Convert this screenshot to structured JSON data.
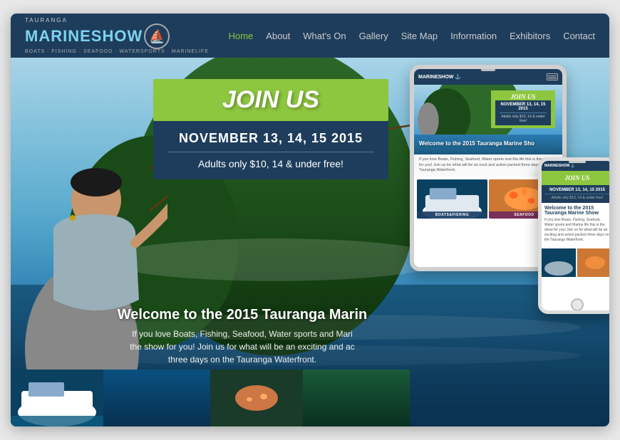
{
  "site": {
    "logo": {
      "top": "TAURANGA",
      "main_marine": "MARINE",
      "main_show": "SHOW",
      "sub": "BOATS · FISHING · SEAFOOD · WATERSPORTS · MARINELIFE"
    },
    "nav": {
      "home": "Home",
      "about": "About",
      "whats_on": "What's On",
      "gallery": "Gallery",
      "site_map": "Site Map",
      "information": "Information",
      "exhibitors": "Exhibitors",
      "contact": "Contact"
    },
    "hero": {
      "join_us": "JOIN US",
      "date": "NOVEMBER 13, 14, 15 2015",
      "price": "Adults only $10, 14 & under free!",
      "welcome_title": "Welcome to the 2015 Tauranga Marin",
      "welcome_desc_line1": "If you love Boats, Fishing, Seafood, Water sports and Mari",
      "welcome_desc_line2": "the show for you! Join us for what will be an exciting and ac",
      "welcome_desc_line3": "three days on the Tauranga Waterfront."
    },
    "ipad": {
      "logo": "MARINESHOW ⚓",
      "join_us": "JOIN US",
      "date": "NOVEMBER 13, 14, 15 2015",
      "price": "Adults only $10, 14 & under free!",
      "welcome_title": "Welcome to the 2015 Tauranga Marine Sho",
      "desc": "If you love Boats, Fishing, Seafood, Water sports and Ma life this is the show for you! Join us for what will be an excit and action packed three days on the Tauranga Waterfront.",
      "gallery_boat": "BOATS&FISHING",
      "gallery_seafood": "SEAFOOD"
    },
    "iphone": {
      "logo": "MARINESHOW ⚓",
      "join_us": "JOIN US",
      "date": "NOVEMBER 13, 14, 15 2015",
      "price": "Adults only $10, 14 & under free!",
      "welcome_title": "Welcome to the 2015 Tauranga Marine Show",
      "desc": "If you love Boats, Fishing, Seafood, Water sports and Marine life this is the show for you! Join us for what will be an exciting and action packed three days on the Tauranga Waterfront."
    },
    "colors": {
      "navy": "#1e3d5c",
      "green": "#8dc63f",
      "blue": "#2a7ab0",
      "accent_blue": "#7dd3f0"
    }
  }
}
